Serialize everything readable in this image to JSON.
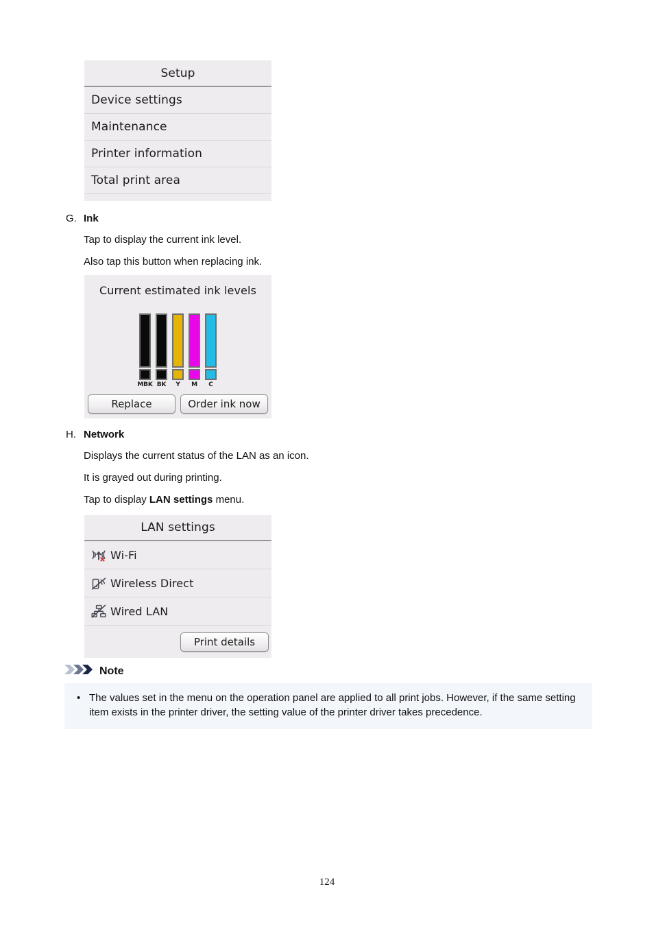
{
  "setup_screen": {
    "title": "Setup",
    "items": [
      {
        "label": "Device settings"
      },
      {
        "label": "Maintenance"
      },
      {
        "label": "Printer information"
      },
      {
        "label": "Total print area"
      }
    ]
  },
  "section_g": {
    "letter": "G.",
    "title": "Ink",
    "lines": [
      "Tap to display the current ink level.",
      "Also tap this button when replacing ink."
    ]
  },
  "ink_screen": {
    "title": "Current estimated ink levels",
    "tanks": [
      {
        "code": "MBK",
        "color": "#0a0a0a",
        "level": 100
      },
      {
        "code": "BK",
        "color": "#0a0a0a",
        "level": 100
      },
      {
        "code": "Y",
        "color": "#e4b505",
        "level": 100
      },
      {
        "code": "M",
        "color": "#ea06ea",
        "level": 100
      },
      {
        "code": "C",
        "color": "#22bce6",
        "level": 100
      }
    ],
    "replace_label": "Replace",
    "order_label": "Order ink now"
  },
  "section_h": {
    "letter": "H.",
    "title": "Network",
    "line1": "Displays the current status of the LAN as an icon.",
    "line2": "It is grayed out during printing.",
    "line3_prefix": "Tap to display ",
    "line3_bold": "LAN settings",
    "line3_suffix": " menu."
  },
  "lan_screen": {
    "title": "LAN settings",
    "items": [
      {
        "icon": "wifi-disabled-icon",
        "label": "Wi-Fi"
      },
      {
        "icon": "wireless-direct-disabled-icon",
        "label": "Wireless Direct"
      },
      {
        "icon": "wired-lan-disabled-icon",
        "label": "Wired LAN"
      }
    ],
    "print_details_label": "Print details"
  },
  "note": {
    "title": "Note",
    "bullet": "•",
    "items": [
      "The values set in the menu on the operation panel are applied to all print jobs. However, if the same setting item exists in the printer driver, the setting value of the printer driver takes precedence."
    ]
  },
  "footer": {
    "page_number": "124"
  }
}
